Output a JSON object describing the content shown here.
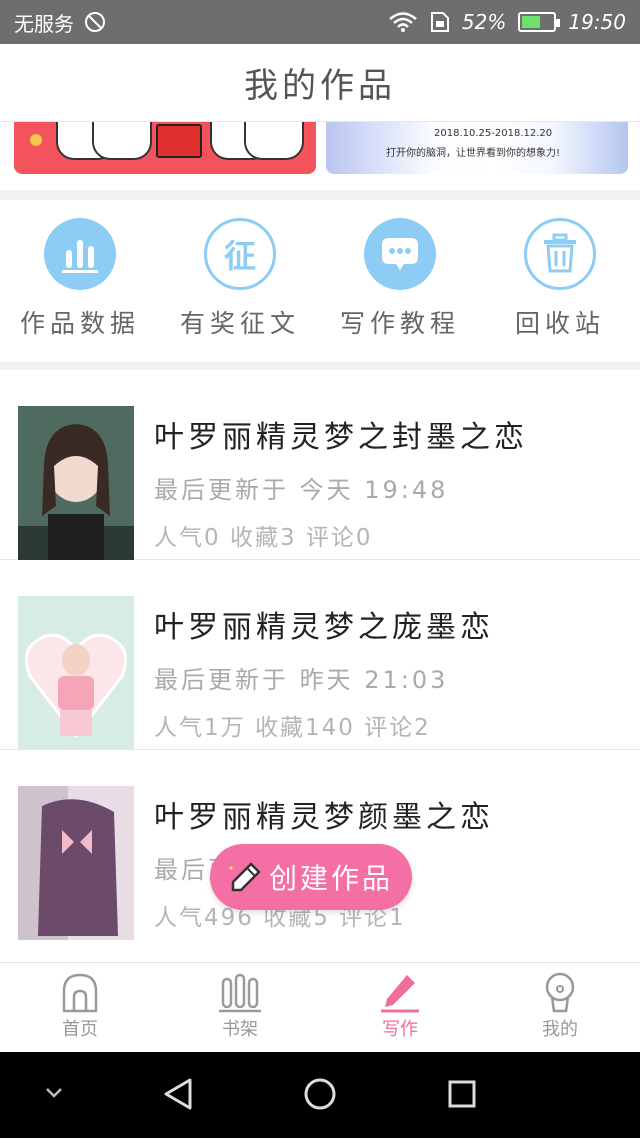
{
  "status": {
    "carrier": "无服务",
    "battery": "52%",
    "time": "19:50"
  },
  "header": {
    "title": "我的作品"
  },
  "banners": {
    "right_date": "2018.10.25-2018.12.20",
    "right_tagline": "打开你的脑洞，让世界看到你的想象力!"
  },
  "features": [
    {
      "label": "作品数据",
      "icon": "bar-chart-icon"
    },
    {
      "label": "有奖征文",
      "icon": "contest-icon",
      "glyph": "征"
    },
    {
      "label": "写作教程",
      "icon": "chat-bubble-icon"
    },
    {
      "label": "回收站",
      "icon": "trash-icon"
    }
  ],
  "works": [
    {
      "title": "叶罗丽精灵梦之封墨之恋",
      "updated": "最后更新于 今天 19:48",
      "stats": "人气0 收藏3 评论0"
    },
    {
      "title": "叶罗丽精灵梦之庞墨恋",
      "updated": "最后更新于 昨天 21:03",
      "stats": "人气1万 收藏140 评论2"
    },
    {
      "title": "叶罗丽精灵梦颜墨之恋",
      "updated": "最后更新于",
      "stats": "人气496 收藏5 评论1"
    }
  ],
  "fab": {
    "label": "创建作品"
  },
  "tabs": [
    {
      "label": "首页",
      "icon": "home-icon",
      "active": false
    },
    {
      "label": "书架",
      "icon": "bookshelf-icon",
      "active": false
    },
    {
      "label": "写作",
      "icon": "pen-icon",
      "active": true
    },
    {
      "label": "我的",
      "icon": "profile-icon",
      "active": false
    }
  ],
  "colors": {
    "accent": "#f06e9c",
    "feature_blue": "#8dcdf5"
  },
  "battery_level": 0.52
}
